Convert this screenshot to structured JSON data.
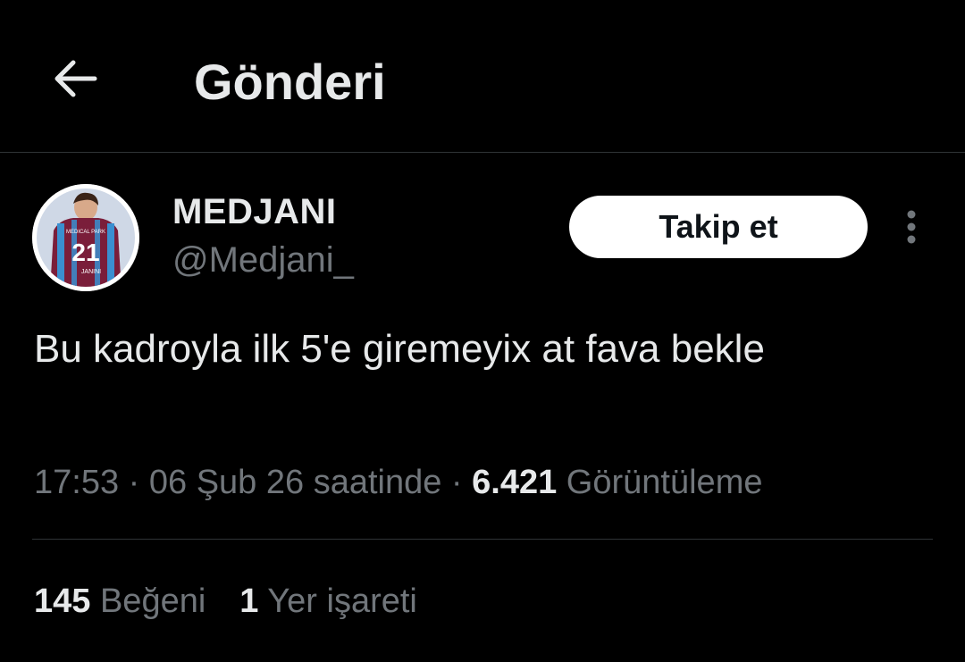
{
  "header": {
    "title": "Gönderi",
    "back_icon": "arrow-left-icon"
  },
  "author": {
    "display_name": "MEDJANI",
    "handle": "@Medjani_",
    "avatar_jersey_number": "21",
    "avatar_jersey_sponsor": "MEDICAL PARK",
    "avatar_jersey_name": "JANINI"
  },
  "actions": {
    "follow_label": "Takip et",
    "more_icon": "more-vertical-icon"
  },
  "tweet": {
    "text": "Bu kadroyla ilk 5'e giremeyix at fava bekle"
  },
  "meta": {
    "time": "17:53",
    "separator1": " · ",
    "date": "06 Şub 26 saatinde",
    "separator2": " · ",
    "views_count": "6.421",
    "views_label": " Görüntüleme"
  },
  "stats": {
    "likes_count": "145",
    "likes_label": " Beğeni",
    "bookmarks_count": "1",
    "bookmarks_label": " Yer işareti"
  },
  "colors": {
    "background": "#000000",
    "primary_text": "#e7e9ea",
    "secondary_text": "#71767b",
    "divider": "#2f3336",
    "follow_bg": "#ffffff",
    "jersey_maroon": "#7a1e3a",
    "jersey_blue": "#3a8fd0"
  }
}
